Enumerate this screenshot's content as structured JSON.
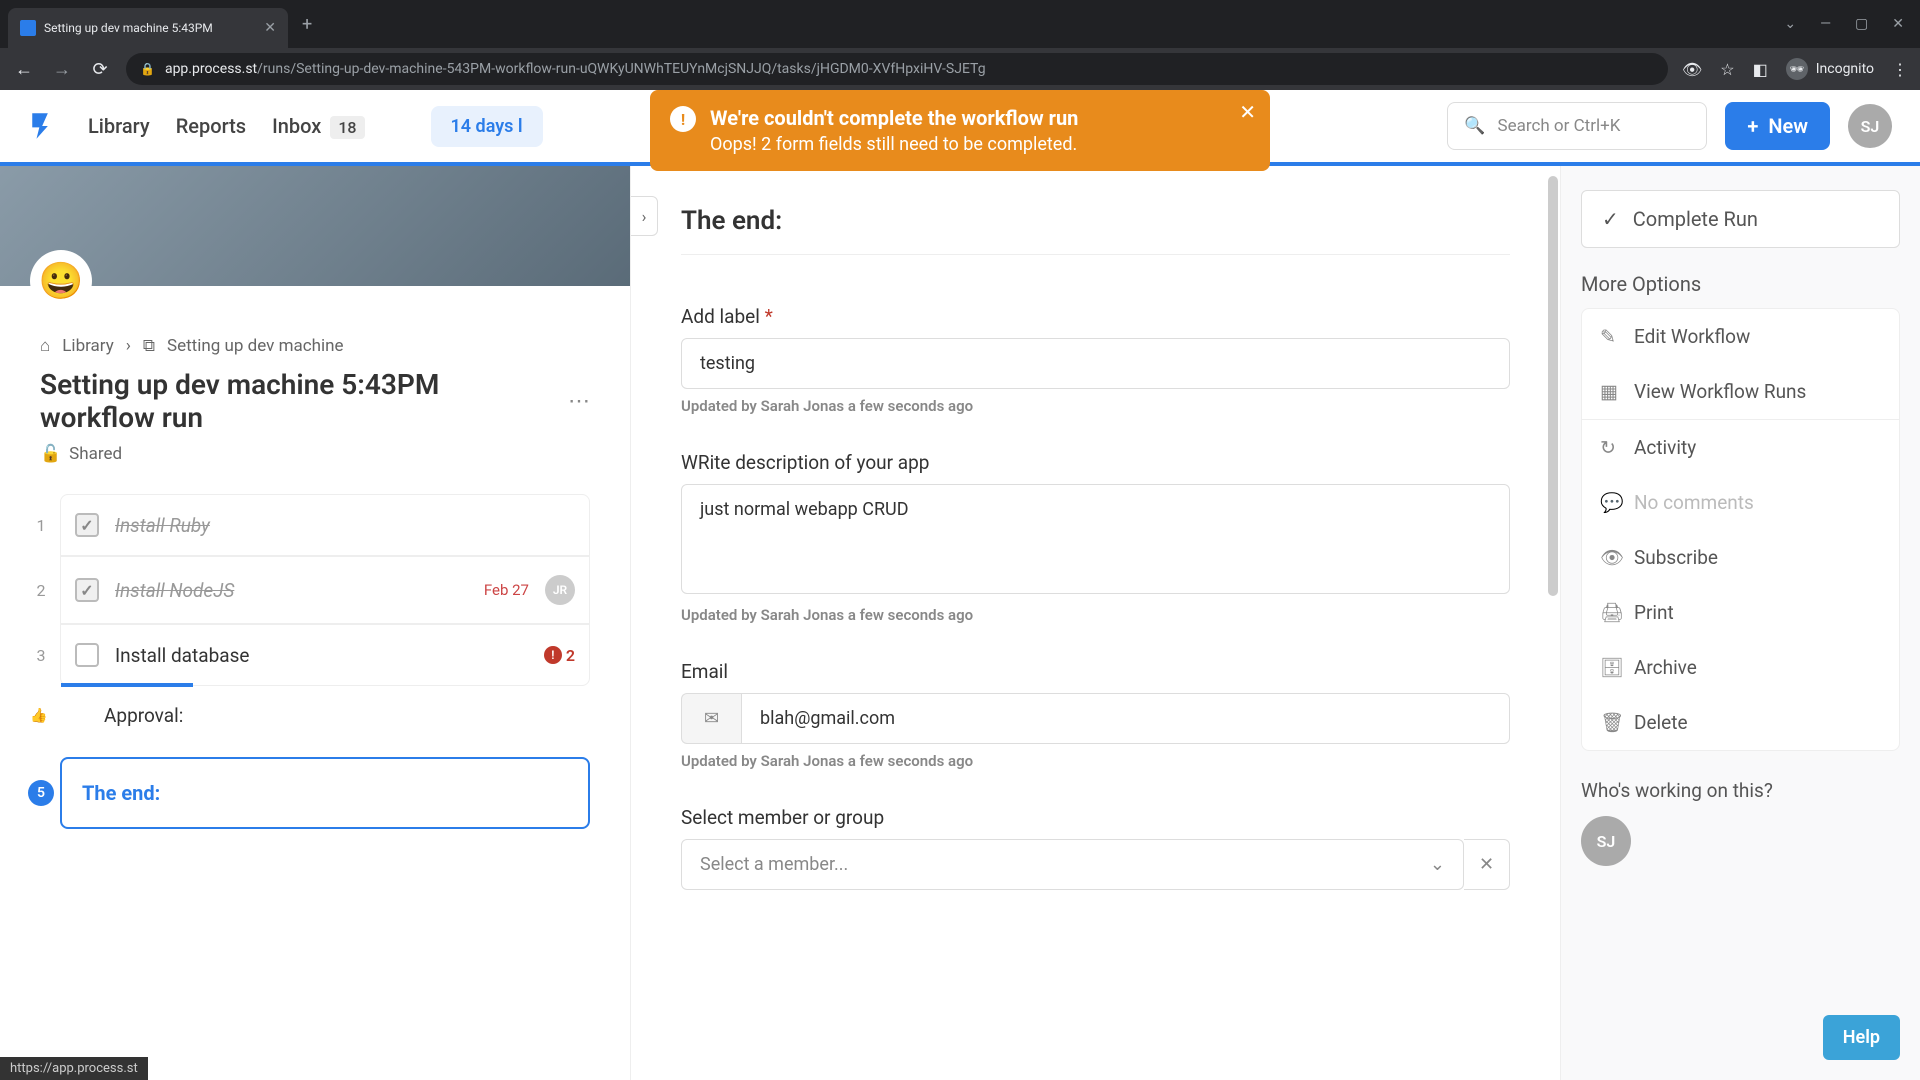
{
  "browser": {
    "tab_title": "Setting up dev machine 5:43PM",
    "url_host": "app.process.st",
    "url_path": "/runs/Setting-up-dev-machine-543PM-workflow-run-uQWKyUNWhTEUYnMcjSNJJQ/tasks/jHGDM0-XVfHpxiHV-SJETg",
    "incognito": "Incognito",
    "status_url": "https://app.process.st"
  },
  "header": {
    "nav": {
      "library": "Library",
      "reports": "Reports",
      "inbox": "Inbox",
      "inbox_count": "18"
    },
    "trial": "14 days l",
    "search_placeholder": "Search or Ctrl+K",
    "new": "New",
    "avatar": "SJ"
  },
  "toast": {
    "title": "We're couldn't complete the workflow run",
    "message": "Oops! 2 form fields still need to be completed."
  },
  "breadcrumb": {
    "root": "Library",
    "current": "Setting up dev machine"
  },
  "run": {
    "title": "Setting up dev machine 5:43PM workflow run",
    "shared": "Shared"
  },
  "tasks": [
    {
      "num": "1",
      "label": "Install Ruby",
      "done": true
    },
    {
      "num": "2",
      "label": "Install NodeJS",
      "done": true,
      "date": "Feb 27",
      "avatar": "JR"
    },
    {
      "num": "3",
      "label": "Install database",
      "badge": "2",
      "progress": 25
    },
    {
      "num": "",
      "label": "Approval:",
      "approval": true
    },
    {
      "num": "5",
      "label": "The end:",
      "active": true
    }
  ],
  "form": {
    "section": "The end:",
    "label_field": {
      "label": "Add label",
      "required": true,
      "value": "testing",
      "hint": "Updated by Sarah Jonas a few seconds ago"
    },
    "desc_field": {
      "label": "WRite description of your app",
      "value": "just normal webapp CRUD",
      "hint": "Updated by Sarah Jonas a few seconds ago"
    },
    "email_field": {
      "label": "Email",
      "value": "blah@gmail.com",
      "hint": "Updated by Sarah Jonas a few seconds ago"
    },
    "member_field": {
      "label": "Select member or group",
      "placeholder": "Select a member..."
    }
  },
  "right": {
    "complete": "Complete Run",
    "more_options": "More Options",
    "options": {
      "edit": "Edit Workflow",
      "view_runs": "View Workflow Runs",
      "activity": "Activity",
      "comments": "No comments",
      "subscribe": "Subscribe",
      "print": "Print",
      "archive": "Archive",
      "delete": "Delete"
    },
    "working": "Who's working on this?",
    "working_avatar": "SJ",
    "help": "Help"
  }
}
